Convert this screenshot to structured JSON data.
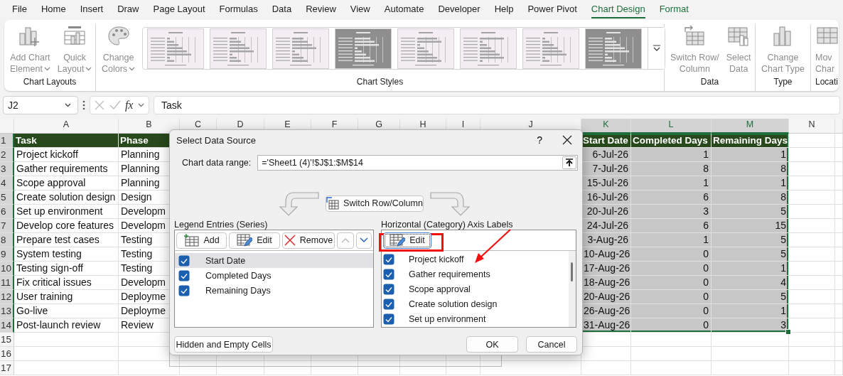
{
  "menu_tabs": [
    {
      "label": "File",
      "selected": false,
      "contextual": false
    },
    {
      "label": "Home",
      "selected": false,
      "contextual": false
    },
    {
      "label": "Insert",
      "selected": false,
      "contextual": false
    },
    {
      "label": "Draw",
      "selected": false,
      "contextual": false
    },
    {
      "label": "Page Layout",
      "selected": false,
      "contextual": false
    },
    {
      "label": "Formulas",
      "selected": false,
      "contextual": false
    },
    {
      "label": "Data",
      "selected": false,
      "contextual": false
    },
    {
      "label": "Review",
      "selected": false,
      "contextual": false
    },
    {
      "label": "View",
      "selected": false,
      "contextual": false
    },
    {
      "label": "Automate",
      "selected": false,
      "contextual": false
    },
    {
      "label": "Developer",
      "selected": false,
      "contextual": false
    },
    {
      "label": "Help",
      "selected": false,
      "contextual": false
    },
    {
      "label": "Power Pivot",
      "selected": false,
      "contextual": false
    },
    {
      "label": "Chart Design",
      "selected": true,
      "contextual": true
    },
    {
      "label": "Format",
      "selected": false,
      "contextual": true
    }
  ],
  "ribbon": {
    "groups": [
      {
        "label": "Chart Layouts",
        "buttons": [
          {
            "kind": "add-chart-element",
            "lines": [
              "Add Chart",
              "Element"
            ],
            "dropdown": true,
            "disabled": true
          },
          {
            "kind": "quick-layout",
            "lines": [
              "Quick",
              "Layout"
            ],
            "dropdown": true,
            "disabled": true
          }
        ]
      },
      {
        "label": "Chart Styles",
        "buttons": [
          {
            "kind": "change-colors",
            "lines": [
              "Change",
              "Colors"
            ],
            "dropdown": true,
            "disabled": true
          }
        ],
        "gallery": [
          {
            "dark": false
          },
          {
            "dark": false
          },
          {
            "dark": false
          },
          {
            "dark": true
          },
          {
            "dark": false
          },
          {
            "dark": false
          },
          {
            "dark": false
          },
          {
            "dark": true
          }
        ]
      },
      {
        "label": "Data",
        "buttons": [
          {
            "kind": "switch-row-column",
            "lines": [
              "Switch Row/",
              "Column"
            ],
            "dropdown": false,
            "disabled": true
          },
          {
            "kind": "select-data",
            "lines": [
              "Select",
              "Data"
            ],
            "dropdown": false,
            "disabled": true
          }
        ]
      },
      {
        "label": "Type",
        "buttons": [
          {
            "kind": "change-chart-type",
            "lines": [
              "Change",
              "Chart Type"
            ],
            "dropdown": false,
            "disabled": true
          }
        ]
      },
      {
        "label": "Locati",
        "buttons": [
          {
            "kind": "move-chart",
            "lines": [
              "Mov",
              "Char"
            ],
            "dropdown": false,
            "disabled": true
          }
        ]
      }
    ]
  },
  "formula_bar": {
    "name_box": "J2",
    "function_label": "fx",
    "formula": "Task"
  },
  "sheet": {
    "columns": [
      {
        "label": "A",
        "selected": false
      },
      {
        "label": "B",
        "selected": false
      },
      {
        "label": "C",
        "selected": false
      },
      {
        "label": "D",
        "selected": false
      },
      {
        "label": "E",
        "selected": false
      },
      {
        "label": "F",
        "selected": false
      },
      {
        "label": "G",
        "selected": false
      },
      {
        "label": "H",
        "selected": false
      },
      {
        "label": "I",
        "selected": false
      },
      {
        "label": "J",
        "selected": false
      },
      {
        "label": "K",
        "selected": true
      },
      {
        "label": "L",
        "selected": true
      },
      {
        "label": "M",
        "selected": true
      },
      {
        "label": "N",
        "selected": false
      }
    ],
    "rows": [
      {
        "number": "1",
        "selected": true,
        "kind": "header",
        "column_a": "Task",
        "column_b": "Phase",
        "column_k": "Start Date",
        "column_l": "Completed Days",
        "column_m": "Remaining Days"
      },
      {
        "number": "2",
        "selected": true,
        "kind": "data",
        "column_a": "Project kickoff",
        "column_b": "Planning",
        "column_k": "6-Jul-26",
        "column_l": "1",
        "column_m": "1"
      },
      {
        "number": "3",
        "selected": true,
        "kind": "data",
        "column_a": "Gather requirements",
        "column_b": "Planning",
        "column_k": "7-Jul-26",
        "column_l": "8",
        "column_m": "8"
      },
      {
        "number": "4",
        "selected": true,
        "kind": "data",
        "column_a": "Scope approval",
        "column_b": "Planning",
        "column_k": "15-Jul-26",
        "column_l": "1",
        "column_m": "1"
      },
      {
        "number": "5",
        "selected": true,
        "kind": "data",
        "column_a": "Create solution design",
        "column_b": "Design",
        "column_k": "16-Jul-26",
        "column_l": "6",
        "column_m": "8"
      },
      {
        "number": "6",
        "selected": true,
        "kind": "data",
        "column_a": "Set up environment",
        "column_b": "Developm",
        "column_k": "20-Jul-26",
        "column_l": "3",
        "column_m": "5"
      },
      {
        "number": "7",
        "selected": true,
        "kind": "data",
        "column_a": "Develop core features",
        "column_b": "Developm",
        "column_k": "24-Jul-26",
        "column_l": "6",
        "column_m": "15"
      },
      {
        "number": "8",
        "selected": true,
        "kind": "data",
        "column_a": "Prepare test cases",
        "column_b": "Testing",
        "column_k": "3-Aug-26",
        "column_l": "1",
        "column_m": "5"
      },
      {
        "number": "9",
        "selected": true,
        "kind": "data",
        "column_a": "System testing",
        "column_b": "Testing",
        "column_k": "10-Aug-26",
        "column_l": "0",
        "column_m": "5"
      },
      {
        "number": "10",
        "selected": true,
        "kind": "data",
        "column_a": "Testing sign-off",
        "column_b": "Testing",
        "column_k": "17-Aug-26",
        "column_l": "0",
        "column_m": "1"
      },
      {
        "number": "11",
        "selected": true,
        "kind": "data",
        "column_a": "Fix critical issues",
        "column_b": "Developm",
        "column_k": "18-Aug-26",
        "column_l": "0",
        "column_m": "4"
      },
      {
        "number": "12",
        "selected": true,
        "kind": "data",
        "column_a": "User training",
        "column_b": "Deployme",
        "column_k": "20-Aug-26",
        "column_l": "0",
        "column_m": "5"
      },
      {
        "number": "13",
        "selected": true,
        "kind": "data",
        "column_a": "Go-live",
        "column_b": "Deployme",
        "column_k": "26-Aug-26",
        "column_l": "0",
        "column_m": "1"
      },
      {
        "number": "14",
        "selected": true,
        "kind": "data",
        "column_a": "Post-launch review",
        "column_b": "Review",
        "column_k": "31-Aug-26",
        "column_l": "0",
        "column_m": "3"
      },
      {
        "number": "15",
        "selected": false,
        "kind": "empty"
      },
      {
        "number": "16",
        "selected": false,
        "kind": "empty"
      },
      {
        "number": "17",
        "selected": false,
        "kind": "empty"
      }
    ]
  },
  "dialog": {
    "title": "Select Data Source",
    "help": "?",
    "range_label": "Chart data range:",
    "range_value": "='Sheet1 (4)'!$J$1:$M$14",
    "switch_button": "Switch Row/Column",
    "legend": {
      "label": "Legend Entries (Series)",
      "buttons": [
        {
          "kind": "add",
          "label": "Add",
          "disabled": false
        },
        {
          "kind": "edit",
          "label": "Edit",
          "disabled": false
        },
        {
          "kind": "remove",
          "label": "Remove",
          "disabled": false
        },
        {
          "kind": "up",
          "disabled": true
        },
        {
          "kind": "down",
          "disabled": false
        }
      ],
      "items": [
        {
          "label": "Start Date",
          "checked": true,
          "selected": true
        },
        {
          "label": "Completed Days",
          "checked": true,
          "selected": false
        },
        {
          "label": "Remaining Days",
          "checked": true,
          "selected": false
        }
      ]
    },
    "axis": {
      "label": "Horizontal (Category) Axis Labels",
      "edit_button": "Edit",
      "items": [
        {
          "label": "Project kickoff",
          "checked": true,
          "selected": false
        },
        {
          "label": "Gather requirements",
          "checked": true,
          "selected": false
        },
        {
          "label": "Scope approval",
          "checked": true,
          "selected": false
        },
        {
          "label": "Create solution design",
          "checked": true,
          "selected": false
        },
        {
          "label": "Set up environment",
          "checked": true,
          "selected": false
        }
      ]
    },
    "hidden_cells_button": "Hidden and Empty Cells",
    "ok_button": "OK",
    "cancel_button": "Cancel"
  }
}
